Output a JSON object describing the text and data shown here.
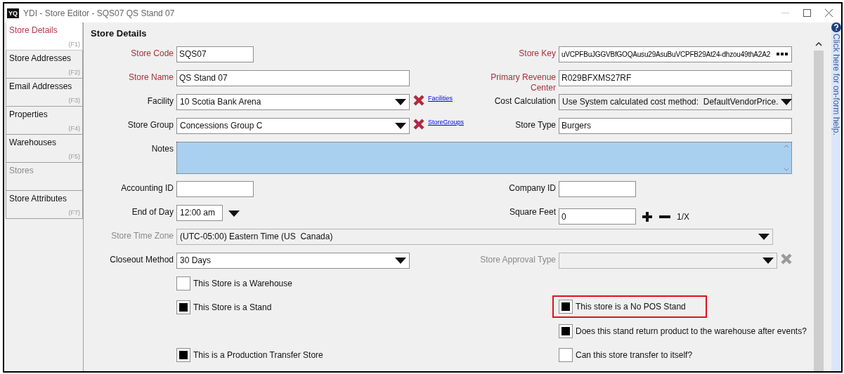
{
  "window": {
    "title": "YDI - Store Editor - SQS07 QS Stand 07",
    "logo": "YQ"
  },
  "tabs": [
    {
      "label": "Store Details",
      "shortcut": "(F1)",
      "selected": true,
      "disabled": false
    },
    {
      "label": "Store Addresses",
      "shortcut": "(F2)",
      "selected": false,
      "disabled": false
    },
    {
      "label": "Email Addresses",
      "shortcut": "(F3)",
      "selected": false,
      "disabled": false
    },
    {
      "label": "Properties",
      "shortcut": "(F4)",
      "selected": false,
      "disabled": false
    },
    {
      "label": "Warehouses",
      "shortcut": "(F5)",
      "selected": false,
      "disabled": false
    },
    {
      "label": "Stores",
      "selected": false,
      "disabled": true
    },
    {
      "label": "Store Attributes",
      "shortcut": "(F7)",
      "selected": false,
      "disabled": false
    }
  ],
  "heading": "Store Details",
  "help_text": "Click here for on-form help.",
  "rows": [
    {
      "left": {
        "kind": "short_text",
        "label": "Store Code",
        "required": true,
        "value": "SQS07"
      },
      "right": {
        "kind": "key",
        "label": "Store Key",
        "required": true,
        "value": "uVCPFBuJGGVBfGOQAusu29AsuBuVCPFB29At24-dhzou49thA2A2"
      }
    },
    {
      "left": {
        "kind": "text",
        "label": "Store Name",
        "required": true,
        "value": "QS Stand 07"
      },
      "right": {
        "kind": "text",
        "label": "Primary Revenue Center",
        "required": true,
        "value": "R029BFXMS27RF"
      }
    },
    {
      "left": {
        "kind": "select",
        "label": "Facility",
        "value": "10 Scotia Bank Arena",
        "clearable": true,
        "link": "Facilities"
      },
      "right": {
        "kind": "select",
        "label": "Cost Calculation",
        "value": "Use System calculated cost method:  DefaultVendorPrice.",
        "readonly": true
      }
    },
    {
      "left": {
        "kind": "select",
        "label": "Store Group",
        "value": "Concessions Group C",
        "clearable": true,
        "link": "StoreGroups"
      },
      "right": {
        "kind": "text",
        "label": "Store Type",
        "value": "Burgers"
      }
    },
    {
      "left": {
        "kind": "textarea",
        "label": "Notes"
      }
    },
    {
      "left": {
        "kind": "short_text",
        "label": "Accounting ID"
      },
      "right": {
        "kind": "short_text",
        "label": "Company ID"
      }
    },
    {
      "left": {
        "kind": "time_select",
        "label": "End of Day",
        "value": "12:00 am"
      },
      "right": {
        "kind": "number",
        "label": "Square Feet",
        "value": "0",
        "extra": "1/X"
      }
    },
    {
      "left": {
        "kind": "select",
        "label": "Store Time Zone",
        "value": "(UTC-05:00) Eastern Time (US  Canada)",
        "disabled": true
      }
    },
    {
      "left": {
        "kind": "select",
        "label": "Closeout Method",
        "value": "30 Days"
      },
      "right": {
        "kind": "select",
        "label": "Store Approval Type",
        "disabled": true,
        "clearable": true
      }
    },
    {
      "left": {
        "kind": "checkbox",
        "label": "This Store is a Warehouse",
        "checked": false
      }
    },
    {
      "left": {
        "kind": "checkbox",
        "label": "This Store is a Stand",
        "checked": true
      },
      "right": {
        "kind": "checkbox",
        "label": "This store is a No POS Stand",
        "checked": true,
        "highlighted": true
      }
    },
    {
      "right": {
        "kind": "checkbox",
        "label": "Does this stand return product to the warehouse after events?",
        "checked": true
      }
    },
    {
      "left": {
        "kind": "checkbox",
        "label": "This is a Production Transfer Store",
        "checked": true
      },
      "right": {
        "kind": "checkbox",
        "label": "Can this store transfer to itself?",
        "checked": false
      }
    }
  ]
}
